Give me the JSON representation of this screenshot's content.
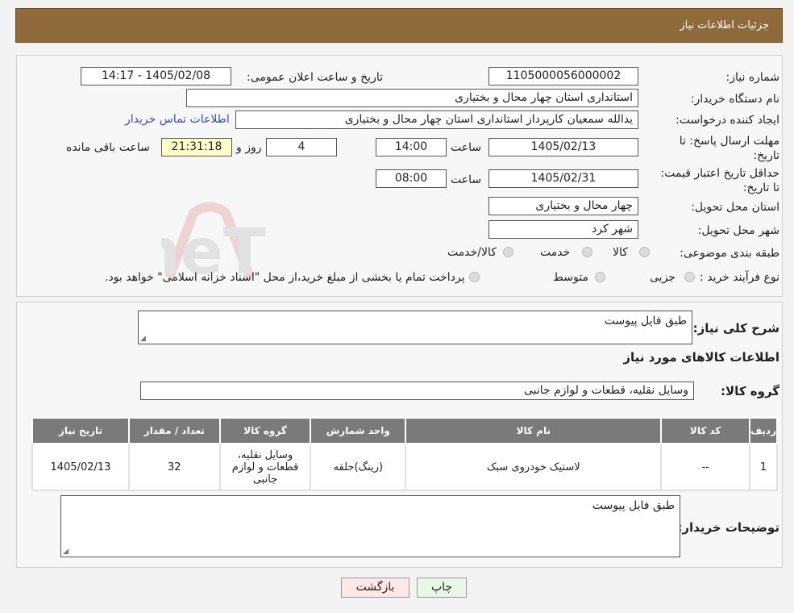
{
  "header": {
    "title": "جزئیات اطلاعات نیاز"
  },
  "form": {
    "need_number_label": "شماره نیاز:",
    "need_number": "1105000056000002",
    "announce_label": "تاریخ و ساعت اعلان عمومی:",
    "announce_value": "1405/02/08 - 14:17",
    "buyer_org_label": "نام دستگاه خریدار:",
    "buyer_org": "استانداری استان چهار محال و بختیاری",
    "creator_label": "ایجاد کننده درخواست:",
    "creator": "یدالله  سمعیان  کارپرداز استانداری استان چهار محال و بختیاری",
    "contact_link": "اطلاعات تماس خریدار",
    "deadline_label": "مهلت ارسال پاسخ: تا تاریخ:",
    "deadline_date": "1405/02/13",
    "time_label": "ساعت",
    "deadline_time": "14:00",
    "days_value": "4",
    "days_label": "روز و",
    "remaining_time": "21:31:18",
    "remaining_label": "ساعت باقی مانده",
    "validity_label": "حداقل تاریخ اعتبار قیمت: تا تاریخ:",
    "validity_date": "1405/02/31",
    "validity_time": "08:00",
    "province_label": "استان محل تحویل:",
    "province": "چهار محال و بختیاری",
    "city_label": "شهر محل تحویل:",
    "city": "شهر کرد",
    "category_label": "طبقه بندی موضوعی:",
    "category_options": [
      "کالا",
      "خدمت",
      "کالا/خدمت"
    ],
    "process_label": "نوع فرآیند خرید :",
    "process_options": [
      "جزیی",
      "متوسط"
    ],
    "process_note": "پرداخت تمام یا بخشی از مبلغ خرید،از محل \"اسناد خزانه اسلامی\" خواهد بود."
  },
  "details": {
    "summary_label": "شرح کلی نیاز:",
    "summary_value": "طبق فایل پیوست",
    "items_title": "اطلاعات کالاهای مورد نیاز",
    "group_label": "گروه کالا:",
    "group_value": "وسایل نقلیه، قطعات و لوازم جانبی",
    "table_headers": [
      "ردیف",
      "کد کالا",
      "نام کالا",
      "واحد شمارش",
      "گروه کالا",
      "تعداد / مقدار",
      "تاریخ نیاز"
    ],
    "rows": [
      [
        "1",
        "--",
        "لاستیک خودروی سبک",
        "(رینگ)حلقه",
        "وسایل نقلیه، قطعات و لوازم جانبی",
        "32",
        "1405/02/13"
      ]
    ],
    "buyer_notes_label": "توضیحات خریدار:",
    "buyer_notes_value": "طبق فایل پیوست"
  },
  "buttons": {
    "print": "چاپ",
    "back": "بازگشت"
  },
  "watermark": {
    "text": "AriaTender.neT"
  },
  "colors": {
    "header": "#8f6a3b",
    "table_header": "#7a7a7a",
    "remaining_bg": "#ffffcc",
    "link": "#2c4ecf"
  }
}
